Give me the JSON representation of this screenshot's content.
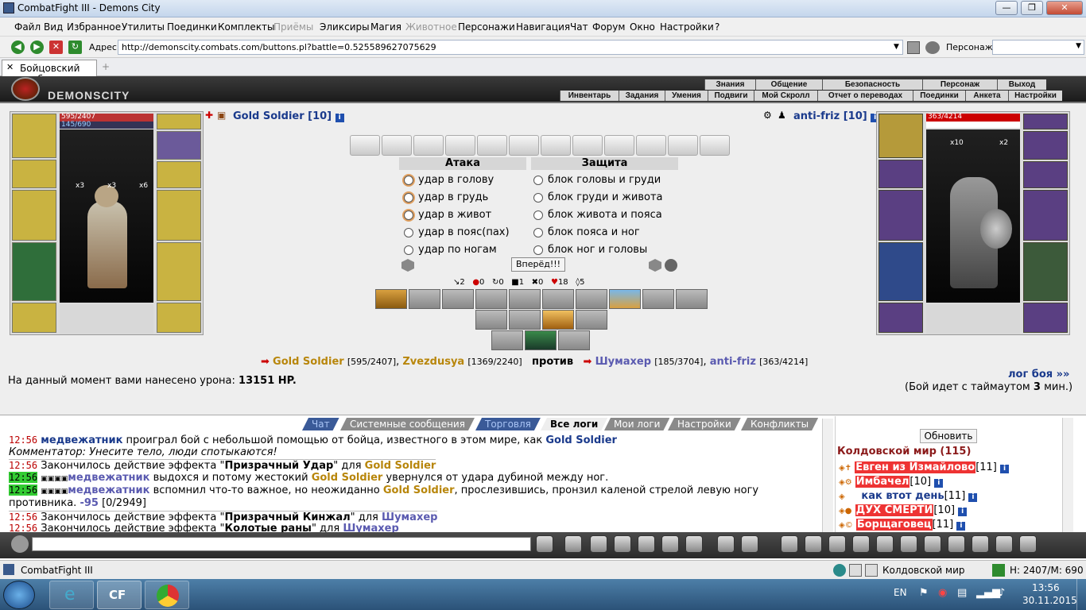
{
  "window": {
    "title": "CombatFight III - Demons City",
    "controls": [
      "—",
      "❐",
      "✕"
    ]
  },
  "menu": [
    "Файл",
    "Вид",
    "Избранное",
    "Утилиты",
    "Поединки",
    "Комплекты",
    "Приёмы",
    "Эликсиры",
    "Магия",
    "Животное",
    "Персонажи",
    "Навигация",
    "Чат",
    "Форум",
    "Окно",
    "Настройки",
    "?"
  ],
  "address": {
    "label": "Адрес:",
    "url": "http://demonscity.combats.com/buttons.pl?battle=0.525589627075629",
    "persona_label": "Персонаж:"
  },
  "tab": {
    "label": "Бойцовский клуб",
    "new": "+"
  },
  "game_header": {
    "logo": "DEMONSCITY",
    "nav_top": [
      "Знания",
      "Общение",
      "Безопасность",
      "Персонаж",
      "Выход"
    ],
    "nav_bottom": [
      "Инвентарь",
      "Задания",
      "Умения",
      "Подвиги",
      "Мой Скролл",
      "Отчет о переводах",
      "Поединки",
      "Анкета",
      "Настройки"
    ]
  },
  "left_fighter": {
    "name": "Gold Soldier [10]",
    "hp": "595/2407",
    "mana": "145/690",
    "counts": [
      "x3",
      "x3",
      "x6"
    ]
  },
  "right_fighter": {
    "name": "anti-friz [10]",
    "hp": "363/4214",
    "counts": [
      "x10",
      "x2"
    ]
  },
  "attack": {
    "header": "Атака",
    "options": [
      "удар в голову",
      "удар в грудь",
      "удар в живот",
      "удар в пояс(пах)",
      "удар по ногам"
    ]
  },
  "defense": {
    "header": "Защита",
    "options": [
      "блок головы и груди",
      "блок груди и живота",
      "блок живота и пояса",
      "блок пояса и ног",
      "блок ног и головы"
    ]
  },
  "forward_button": "Вперёд!!!",
  "stats": [
    "2",
    "0",
    "0",
    "1",
    "0",
    "18",
    "5"
  ],
  "battle": {
    "team1": [
      {
        "name": "Gold Soldier",
        "hp": "[595/2407]"
      },
      {
        "name": "Zvezdusya",
        "hp": "[1369/2240]"
      }
    ],
    "vs": "против",
    "team2": [
      {
        "name": "Шумахер",
        "hp": "[185/3704]"
      },
      {
        "name": "anti-friz",
        "hp": "[363/4214]"
      }
    ],
    "damage_text": "На данный момент вами нанесено урона:",
    "damage_value": "13151 HP.",
    "log_link": "лог боя »»",
    "timeout_text": "(Бой идет с таймаутом",
    "timeout_value": "3",
    "timeout_unit": "мин.)"
  },
  "chat_tabs": [
    "Чат",
    "Системные сообщения",
    "Торговля",
    "Все логи",
    "Мои логи",
    "Настройки",
    "Конфликты"
  ],
  "chat": [
    {
      "time": "12:56",
      "p1": "медвежатник",
      "t1": " проиграл бой с небольшой помощью от бойца, известного в этом мире, как ",
      "p2": "Gold Soldier"
    },
    {
      "comment": "Комментатор: Унесите тело, люди спотыкаются!"
    },
    {
      "time": "12:56",
      "t1": " Закончилось действие эффекта \"",
      "b": "Призрачный Удар",
      "t2": "\" для ",
      "p2": "Gold Soldier"
    },
    {
      "time": "12:56",
      "p1": "медвежатник",
      "t1": " выдохся и потому жестокий ",
      "p2": "Gold Soldier",
      "t2": " увернулся от удара дубиной между ног."
    },
    {
      "time": "12:56",
      "p1": "медвежатник",
      "t1": " вспомнил что-то важное, но неожиданно ",
      "p2": "Gold Soldier",
      "t2": ", прослезившись, пронзил каленой стрелой левую ногу"
    },
    {
      "cont": "противника.",
      "dmg": "-95",
      "hpinfo": "[0/2949]"
    },
    {
      "time": "12:56",
      "t1": " Закончилось действие эффекта \"",
      "b": "Призрачный Кинжал",
      "t2": "\" для ",
      "p2": "Шумахер"
    },
    {
      "time": "12:56",
      "t1": " Закончилось действие эффекта \"",
      "b": "Колотые раны",
      "t2": "\" для ",
      "p2": "Шумахер"
    }
  ],
  "right_list": {
    "refresh": "Обновить",
    "title": "Колдовской мир (115)",
    "users": [
      {
        "name": "Евген из Измайлово",
        "lvl": "[11]"
      },
      {
        "name": "Имбачел",
        "lvl": "[10]"
      },
      {
        "name": "как втот день",
        "lvl": "[11]"
      },
      {
        "name": "ДУХ СМЕРТИ",
        "lvl": "[10]"
      },
      {
        "name": "Борщаговец",
        "lvl": "[11]"
      }
    ]
  },
  "statusbar": {
    "app": "CombatFight III",
    "location": "Колдовской мир",
    "hm": "H: 2407/M: 690"
  },
  "taskbar": {
    "lang": "EN",
    "time": "13:56",
    "date": "30.11.2015"
  }
}
